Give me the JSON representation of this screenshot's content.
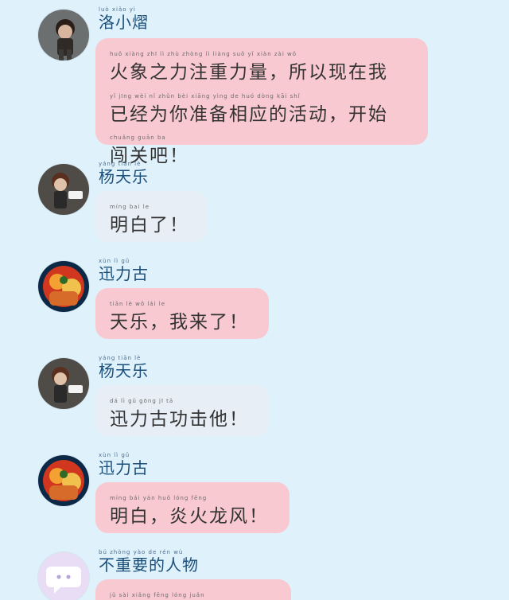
{
  "messages": [
    {
      "name": "洛小熠",
      "name_pinyin": "luò  xiǎo  yì",
      "lines": [
        {
          "pinyin": "huǒ  xiàng  zhī  lì  zhù  zhòng  lì  liàng      suǒ  yǐ  xiàn  zài  wǒ",
          "text": "火象之力注重力量，所以现在我"
        },
        {
          "pinyin": "yǐ  jīng  wèi  nǐ  zhǔn  bèi  xiāng  yìng  de  huó  dòng     kāi  shǐ",
          "text": "已经为你准备相应的活动，开始"
        },
        {
          "pinyin": "chuǎng  guān  ba",
          "text": "闯关吧！"
        }
      ]
    },
    {
      "name": "杨天乐",
      "name_pinyin": "yáng  tiān  lè",
      "lines": [
        {
          "pinyin": "míng  bai  le",
          "text": "明白了！"
        }
      ]
    },
    {
      "name": "迅力古",
      "name_pinyin": "xùn  lì  gǔ",
      "lines": [
        {
          "pinyin": "tiān  lè      wǒ  lái  le",
          "text": "天乐，我来了！"
        }
      ]
    },
    {
      "name": "杨天乐",
      "name_pinyin": "yáng  tiān  lè",
      "lines": [
        {
          "pinyin": "dá  lì  gǔ  gōng  jī  tā",
          "text": "迅力古功击他！"
        }
      ]
    },
    {
      "name": "迅力古",
      "name_pinyin": "xùn  lì  gǔ",
      "lines": [
        {
          "pinyin": "míng  bái      yán  huǒ  lóng  fēng",
          "text": "明白，炎火龙风！"
        }
      ]
    },
    {
      "name": "不重要的人物",
      "name_pinyin": "bú  zhòng  yào  de  rén  wù",
      "lines": [
        {
          "pinyin": "jǔ  sài  xiǎng      fēng  lóng  juǎn",
          "text": ""
        }
      ]
    }
  ],
  "colors": {
    "background": "#dff1fb",
    "bubble_pink": "#f8c9d0",
    "bubble_gray": "#e7eef6",
    "name_color": "#1b4f7a"
  },
  "icons": [
    "avatar-luo-xiao-yi",
    "avatar-yang-tian-le",
    "avatar-xun-li-gu",
    "avatar-robot-chat-icon"
  ]
}
